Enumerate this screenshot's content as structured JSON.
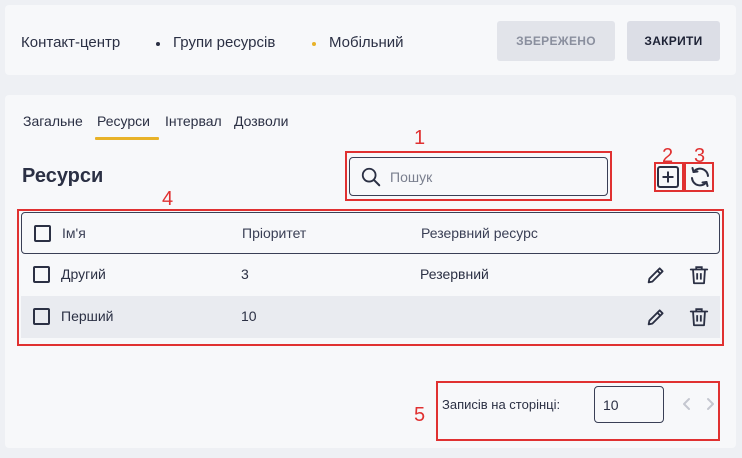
{
  "breadcrumb": {
    "items": [
      {
        "label": "Контакт-центр"
      },
      {
        "label": "Групи ресурсів"
      },
      {
        "label": "Мобільний"
      }
    ]
  },
  "header_actions": {
    "saved_label": "ЗБЕРЕЖЕНО",
    "close_label": "ЗАКРИТИ"
  },
  "tabs": [
    {
      "label": "Загальне",
      "active": false
    },
    {
      "label": "Ресурси",
      "active": true
    },
    {
      "label": "Інтервал",
      "active": false
    },
    {
      "label": "Дозволи",
      "active": false
    }
  ],
  "section": {
    "title": "Ресурси"
  },
  "search": {
    "placeholder": "Пошук",
    "value": ""
  },
  "toolbar": {
    "add_icon": "plus-square-icon",
    "refresh_icon": "refresh-icon"
  },
  "table": {
    "columns": [
      "Ім'я",
      "Пріоритет",
      "Резервний ресурс"
    ],
    "rows": [
      {
        "name": "Другий",
        "priority": "3",
        "backup": "Резервний"
      },
      {
        "name": "Перший",
        "priority": "10",
        "backup": ""
      }
    ]
  },
  "pagination": {
    "label": "Записів на сторінці:",
    "page_size": "10"
  },
  "annotations": {
    "labels": [
      "1",
      "2",
      "3",
      "4",
      "5"
    ],
    "color": "#e03131"
  },
  "colors": {
    "accent": "#e8b228",
    "text": "#2b3044",
    "annotation": "#e03131"
  }
}
